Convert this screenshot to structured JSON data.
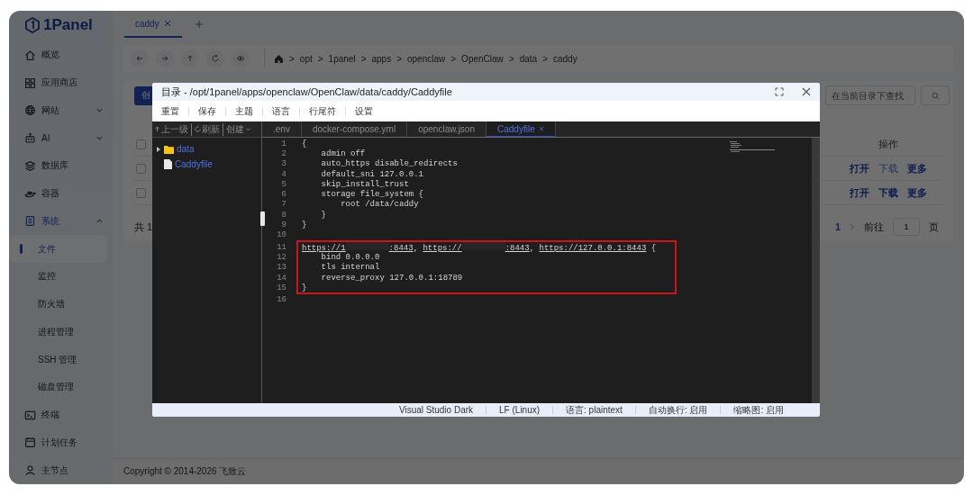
{
  "sidebar": {
    "logo": "1Panel",
    "items": [
      {
        "label": "概览",
        "selected": false
      },
      {
        "label": "应用商店",
        "selected": false
      },
      {
        "label": "网站",
        "selected": false,
        "expanded": false
      },
      {
        "label": "AI",
        "selected": false,
        "expanded": false
      },
      {
        "label": "数据库",
        "selected": false
      },
      {
        "label": "容器",
        "selected": false
      },
      {
        "label": "系统",
        "selected": true,
        "expanded": true,
        "children": [
          {
            "label": "文件",
            "selected": true
          },
          {
            "label": "监控",
            "selected": false
          },
          {
            "label": "防火墙",
            "selected": false
          },
          {
            "label": "进程管理",
            "selected": false
          },
          {
            "label": "SSH 管理",
            "selected": false
          },
          {
            "label": "磁盘管理",
            "selected": false
          }
        ]
      },
      {
        "label": "终端",
        "selected": false
      },
      {
        "label": "计划任务",
        "selected": false
      },
      {
        "label": "主节点",
        "selected": false
      }
    ]
  },
  "tabs": [
    {
      "label": "caddy",
      "selected": true
    }
  ],
  "breadcrumb": {
    "separator": ">",
    "parts": [
      "opt",
      "1panel",
      "apps",
      "openclaw",
      "OpenClaw",
      "data",
      "caddy"
    ]
  },
  "content": {
    "create_button": "创",
    "search": {
      "placeholder": "在当前目录下查找"
    },
    "actions_header": "操作",
    "select_all": {
      "checked": false
    },
    "rows": [
      {
        "checked": false,
        "actions": [
          {
            "label": "打开",
            "disabled": false
          },
          {
            "label": "下载",
            "disabled": true
          },
          {
            "label": "更多",
            "disabled": false
          }
        ]
      },
      {
        "checked": false,
        "actions": [
          {
            "label": "打开",
            "disabled": false
          },
          {
            "label": "下载",
            "disabled": false
          },
          {
            "label": "更多",
            "disabled": false
          }
        ]
      }
    ],
    "total": "共 1",
    "pagination": {
      "page": "1",
      "goto": "前往",
      "goto_value": "1",
      "unit": "页"
    }
  },
  "footer": "Copyright © 2014-2026 飞致云",
  "dialog": {
    "title": "目录 - /opt/1panel/apps/openclaw/OpenClaw/data/caddy/Caddyfile",
    "menu": [
      "重置",
      "保存",
      "主题",
      "语言",
      "行尾符",
      "设置"
    ],
    "file_toolbar": [
      "上一级",
      "刷新",
      "创建"
    ],
    "tree": [
      {
        "name": "data",
        "kind": "folder",
        "expanded": false
      },
      {
        "name": "Caddyfile",
        "kind": "file"
      }
    ],
    "editor_tabs": [
      {
        "label": ".env",
        "selected": false
      },
      {
        "label": "docker-compose.yml",
        "selected": false
      },
      {
        "label": "openclaw.json",
        "selected": false
      },
      {
        "label": "Caddyfile",
        "selected": true
      }
    ],
    "lines": [
      {
        "number": "1",
        "boxed": false,
        "segments": [
          {
            "kind": "text",
            "text": "{"
          }
        ]
      },
      {
        "number": "2",
        "boxed": false,
        "segments": [
          {
            "kind": "text",
            "text": "    admin off"
          }
        ]
      },
      {
        "number": "3",
        "boxed": false,
        "segments": [
          {
            "kind": "text",
            "text": "    auto_https disable_redirects"
          }
        ]
      },
      {
        "number": "4",
        "boxed": false,
        "segments": [
          {
            "kind": "text",
            "text": "    default_sni 127.0.0.1"
          }
        ]
      },
      {
        "number": "5",
        "boxed": false,
        "segments": [
          {
            "kind": "text",
            "text": "    skip_install_trust"
          }
        ]
      },
      {
        "number": "6",
        "boxed": false,
        "segments": [
          {
            "kind": "text",
            "text": "    storage file_system {"
          }
        ]
      },
      {
        "number": "7",
        "boxed": false,
        "segments": [
          {
            "kind": "text",
            "text": "        root /data/caddy"
          }
        ]
      },
      {
        "number": "8",
        "boxed": false,
        "segments": [
          {
            "kind": "text",
            "text": "    }"
          }
        ]
      },
      {
        "number": "9",
        "boxed": false,
        "segments": [
          {
            "kind": "text",
            "text": "}"
          }
        ]
      },
      {
        "number": "10",
        "boxed": false
      },
      {
        "number": "11",
        "boxed": true,
        "segments": [
          {
            "kind": "link",
            "text": "https://1"
          },
          {
            "kind": "redacted"
          },
          {
            "kind": "link",
            "text": ":8443"
          },
          {
            "kind": "text",
            "text": ", "
          },
          {
            "kind": "link",
            "text": "https://"
          },
          {
            "kind": "redacted"
          },
          {
            "kind": "link",
            "text": ":8443"
          },
          {
            "kind": "text",
            "text": ", "
          },
          {
            "kind": "link",
            "text": "https://127.0.0.1:8443"
          },
          {
            "kind": "text",
            "text": " {"
          }
        ]
      },
      {
        "number": "12",
        "boxed": true,
        "segments": [
          {
            "kind": "text",
            "text": "    bind 0.0.0.0"
          }
        ]
      },
      {
        "number": "13",
        "boxed": true,
        "segments": [
          {
            "kind": "text",
            "text": "    tls internal"
          }
        ]
      },
      {
        "number": "14",
        "boxed": true,
        "segments": [
          {
            "kind": "text",
            "text": "    reverse_proxy 127.0.0.1:18789"
          }
        ]
      },
      {
        "number": "15",
        "boxed": true,
        "segments": [
          {
            "kind": "text",
            "text": "}"
          }
        ]
      },
      {
        "number": "16",
        "boxed": false
      }
    ],
    "status_bar": [
      "Visual Studio Dark",
      "LF (Linux)",
      "语言: plaintext",
      "自动换行: 启用",
      "缩略图: 启用"
    ]
  }
}
